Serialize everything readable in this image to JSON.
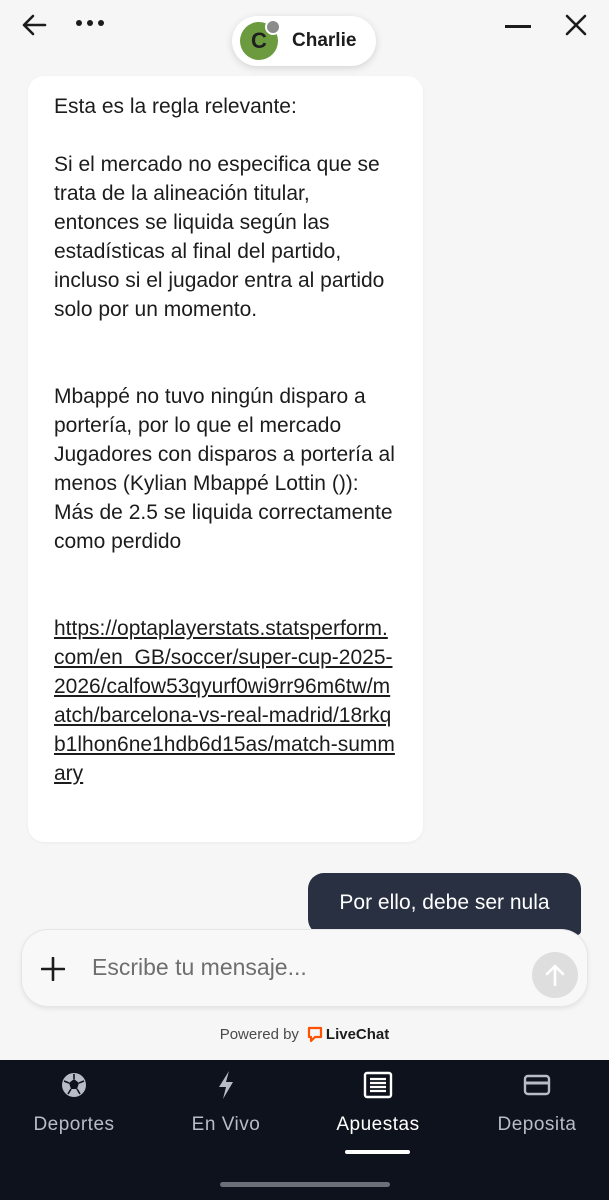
{
  "agent": {
    "initial": "C",
    "name": "Charlie"
  },
  "message_in": {
    "intro": "Esta es la regla relevante:",
    "rule": "Si el mercado no especifica que se trata de la alineación titular, entonces se liquida según las estadísticas al final del partido, incluso si el jugador entra al partido solo por un momento.",
    "explanation": "Mbappé no tuvo ningún disparo a portería, por lo que el mercado Jugadores con disparos a portería al menos (Kylian Mbappé Lottin ()): Más de 2.5 se liquida correctamente como perdido",
    "link": "https://optaplayerstats.statsperform.com/en_GB/soccer/super-cup-2025-2026/calfow53qyurf0wi9rr96m6tw/match/barcelona-vs-real-madrid/18rkqb1lhon6ne1hdb6d15as/match-summary"
  },
  "message_out": {
    "text": "Por ello, debe ser nula"
  },
  "composer": {
    "placeholder": "Escribe tu mensaje..."
  },
  "powered": {
    "prefix": "Powered by",
    "brand": "LiveChat",
    "brand_color": "#ff5100"
  },
  "nav": {
    "items": [
      {
        "label": "Deportes",
        "icon": "soccer-ball-icon"
      },
      {
        "label": "En Vivo",
        "icon": "lightning-icon"
      },
      {
        "label": "Apuestas",
        "icon": "betslip-icon",
        "active": true
      },
      {
        "label": "Deposita",
        "icon": "wallet-icon"
      }
    ]
  },
  "colors": {
    "outgoing_bubble": "#283041",
    "nav_bg": "#0d121c",
    "avatar": "#6b9a3f"
  }
}
